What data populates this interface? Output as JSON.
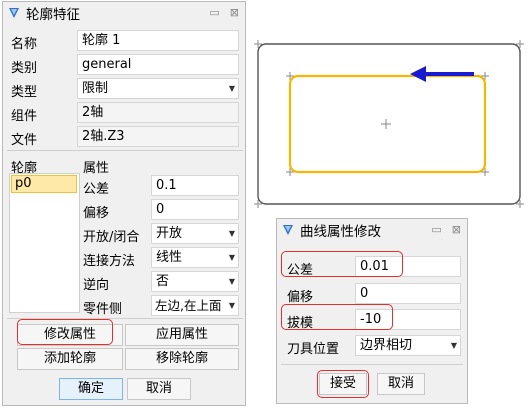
{
  "left_panel": {
    "title": "轮廓特征",
    "title_buttons": {
      "pin": "▭",
      "close": "⊠"
    },
    "name_label": "名称",
    "name_value": "轮廓 1",
    "category_label": "类别",
    "category_value": "general",
    "type_label": "类型",
    "type_value": "限制",
    "component_label": "组件",
    "component_value": "2轴",
    "file_label": "文件",
    "file_value": "2轴.Z3",
    "profile_label": "轮廓",
    "attributes_label": "属性",
    "profile_items": [
      "p0"
    ],
    "tolerance_label": "公差",
    "tolerance_value": "0.1",
    "offset_label": "偏移",
    "offset_value": "0",
    "open_close_label": "开放/闭合",
    "open_close_value": "开放",
    "connect_label": "连接方法",
    "connect_value": "线性",
    "reverse_label": "逆向",
    "reverse_value": "否",
    "part_side_label": "零件侧",
    "part_side_value": "左边,在上面",
    "modify_button": "修改属性",
    "apply_button": "应用属性",
    "add_button": "添加轮廓",
    "remove_button": "移除轮廓",
    "ok_button": "确定",
    "cancel_button": "取消"
  },
  "curve_dialog": {
    "title": "曲线属性修改",
    "title_buttons": {
      "pin": "▭",
      "close": "⊠"
    },
    "tolerance_label": "公差",
    "tolerance_value": "0.01",
    "offset_label": "偏移",
    "offset_value": "0",
    "draft_label": "拔模",
    "draft_value": "-10",
    "tool_pos_label": "刀具位置",
    "tool_pos_value": "边界相切",
    "accept_button": "接受",
    "cancel_button": "取消"
  },
  "colors": {
    "highlight_red": "#e0302f",
    "curve_orange": "#f5b800",
    "arrow_blue": "#1a1ad0",
    "selected_item": "#ffe9a8"
  },
  "icons": [
    "feature-icon",
    "curve-icon",
    "dropdown-arrow-icon",
    "direction-arrow-icon",
    "pin-icon",
    "close-icon"
  ]
}
